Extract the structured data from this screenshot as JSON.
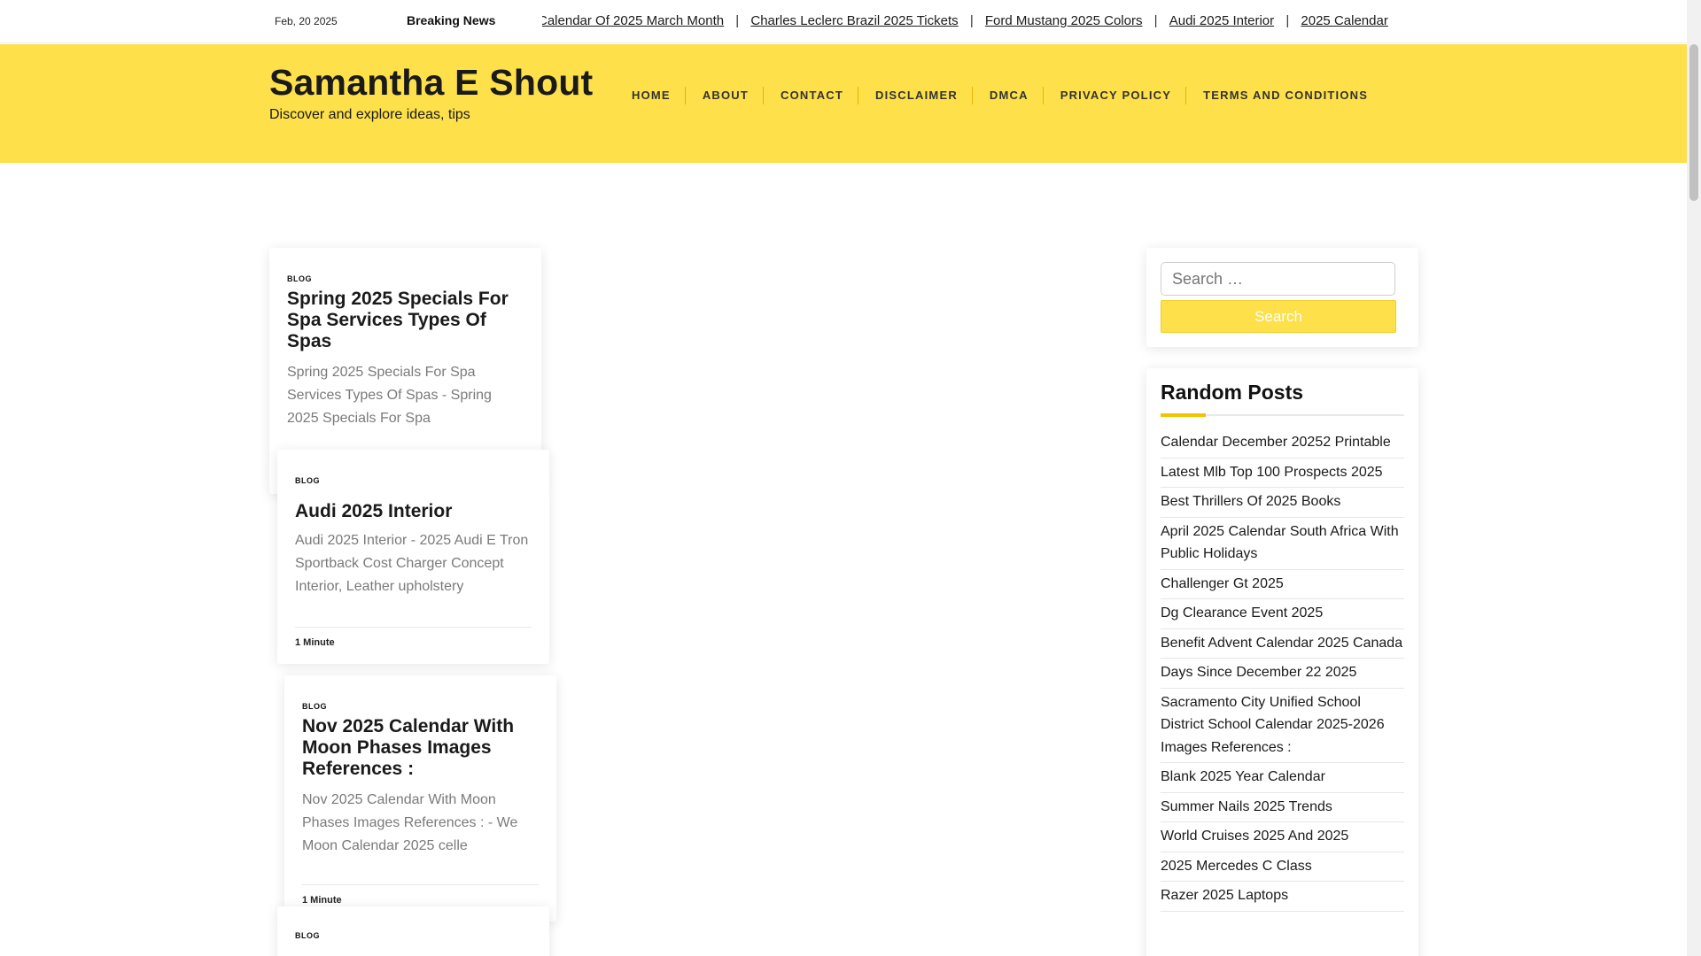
{
  "topbar": {
    "date": "Feb, 20 2025",
    "breaking_label": "Breaking News",
    "ticker": [
      "Calendar Of 2025 March Month",
      "Charles Leclerc Brazil 2025 Tickets",
      "Ford Mustang 2025 Colors",
      "Audi 2025 Interior",
      "2025 Calendar"
    ],
    "separator": "|"
  },
  "header": {
    "site_title": "Samantha E Shout",
    "tagline": "Discover and explore ideas, tips",
    "nav": [
      "HOME",
      "ABOUT",
      "CONTACT",
      "DISCLAIMER",
      "DMCA",
      "PRIVACY POLICY",
      "TERMS AND CONDITIONS"
    ],
    "background_color": "#fde04a"
  },
  "posts": [
    {
      "category": "BLOG",
      "title": "Spring 2025 Specials For Spa Services Types Of Spas",
      "excerpt": "Spring 2025 Specials For Spa Services Types Of Spas - Spring 2025 Specials For Spa"
    },
    {
      "category": "BLOG",
      "title": "Audi 2025 Interior",
      "excerpt": "Audi 2025 Interior - 2025 Audi E Tron Sportback Cost Charger Concept Interior, Leather upholstery",
      "read_time": "1 Minute"
    },
    {
      "category": "BLOG",
      "title": "Nov 2025 Calendar With Moon Phases Images References :",
      "excerpt": "Nov 2025 Calendar With Moon Phases Images References : - We Moon Calendar 2025 celle",
      "read_time": "1 Minute"
    },
    {
      "category": "BLOG"
    }
  ],
  "sidebar": {
    "search_placeholder": "Search …",
    "search_button": "Search",
    "random_posts_title": "Random Posts",
    "random_posts": [
      "Calendar December 20252 Printable",
      "Latest Mlb Top 100 Prospects 2025",
      "Best Thrillers Of 2025 Books",
      "April 2025 Calendar South Africa With Public Holidays",
      "Challenger Gt 2025",
      "Dg Clearance Event 2025",
      "Benefit Advent Calendar 2025 Canada",
      "Days Since December 22 2025",
      "Sacramento City Unified School District School Calendar 2025-2026 Images References :",
      "Blank 2025 Year Calendar",
      "Summer Nails 2025 Trends",
      "World Cruises 2025 And 2025",
      "2025 Mercedes C Class",
      "Razer 2025 Laptops"
    ]
  }
}
